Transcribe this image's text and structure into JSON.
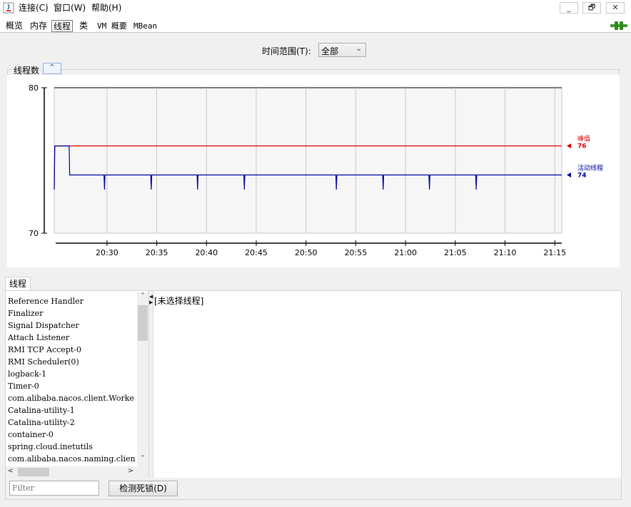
{
  "menu": {
    "items": [
      "连接(C)",
      "窗口(W)",
      "帮助(H)"
    ]
  },
  "window_controls": {
    "minimize": "_",
    "restore": "🗗",
    "close": "✕"
  },
  "tabs": [
    {
      "label": "概览",
      "active": false
    },
    {
      "label": "内存",
      "active": false
    },
    {
      "label": "线程",
      "active": true
    },
    {
      "label": "类",
      "active": false
    },
    {
      "label": "VM 概要",
      "active": false
    },
    {
      "label": "MBean",
      "active": false
    }
  ],
  "time_range": {
    "label": "时间范围(T):",
    "value": "全部"
  },
  "chart_panel": {
    "title": "线程数",
    "collapse_glyph": "⌃"
  },
  "chart_data": {
    "type": "line",
    "ylim": [
      70,
      80
    ],
    "yticks": [
      "80",
      "70"
    ],
    "xticks": [
      "20:30",
      "20:35",
      "20:40",
      "20:45",
      "20:50",
      "20:55",
      "21:00",
      "21:05",
      "21:10",
      "21:15"
    ],
    "grid": true,
    "legend_position": "right",
    "series": [
      {
        "name": "峰值",
        "color": "#e00000",
        "last_value": "76",
        "points": [
          [
            0,
            73
          ],
          [
            0.05,
            76
          ],
          [
            1.5,
            76
          ],
          [
            51.0,
            76
          ]
        ]
      },
      {
        "name": "活动线程",
        "color": "#0000a0",
        "last_value": "74",
        "points": [
          [
            0,
            73
          ],
          [
            0.05,
            76
          ],
          [
            1.5,
            76
          ],
          [
            1.55,
            74
          ],
          [
            5.0,
            74
          ],
          [
            5.05,
            73
          ],
          [
            5.1,
            74
          ],
          [
            9.7,
            74
          ],
          [
            9.75,
            73
          ],
          [
            9.8,
            74
          ],
          [
            14.35,
            74
          ],
          [
            14.4,
            73
          ],
          [
            14.45,
            74
          ],
          [
            19.05,
            74
          ],
          [
            19.1,
            73
          ],
          [
            19.15,
            74
          ],
          [
            28.3,
            74
          ],
          [
            28.35,
            73
          ],
          [
            28.4,
            74
          ],
          [
            33.0,
            74
          ],
          [
            33.05,
            73
          ],
          [
            33.1,
            74
          ],
          [
            37.65,
            74
          ],
          [
            37.7,
            73
          ],
          [
            37.75,
            74
          ],
          [
            42.35,
            74
          ],
          [
            42.4,
            73
          ],
          [
            42.45,
            74
          ],
          [
            51.0,
            74
          ]
        ]
      }
    ]
  },
  "threads_panel": {
    "tab_label": "线程",
    "items": [
      "Reference Handler",
      "Finalizer",
      "Signal Dispatcher",
      "Attach Listener",
      "RMI TCP Accept-0",
      "RMI Scheduler(0)",
      "logback-1",
      "Timer-0",
      "com.alibaba.nacos.client.Worke",
      "Catalina-utility-1",
      "Catalina-utility-2",
      "container-0",
      "spring.cloud.inetutils",
      "com.alibaba.nacos.naming.clien"
    ],
    "detail_text": "[未选择线程]",
    "filter_placeholder": "Filter",
    "detect_deadlock_label": "检测死锁(D)"
  },
  "colors": {
    "accent_tab_border": "#7a7a7a",
    "peak_line": "#e00000",
    "live_line": "#0000a0",
    "connection_icon": "#3a9a2a"
  }
}
